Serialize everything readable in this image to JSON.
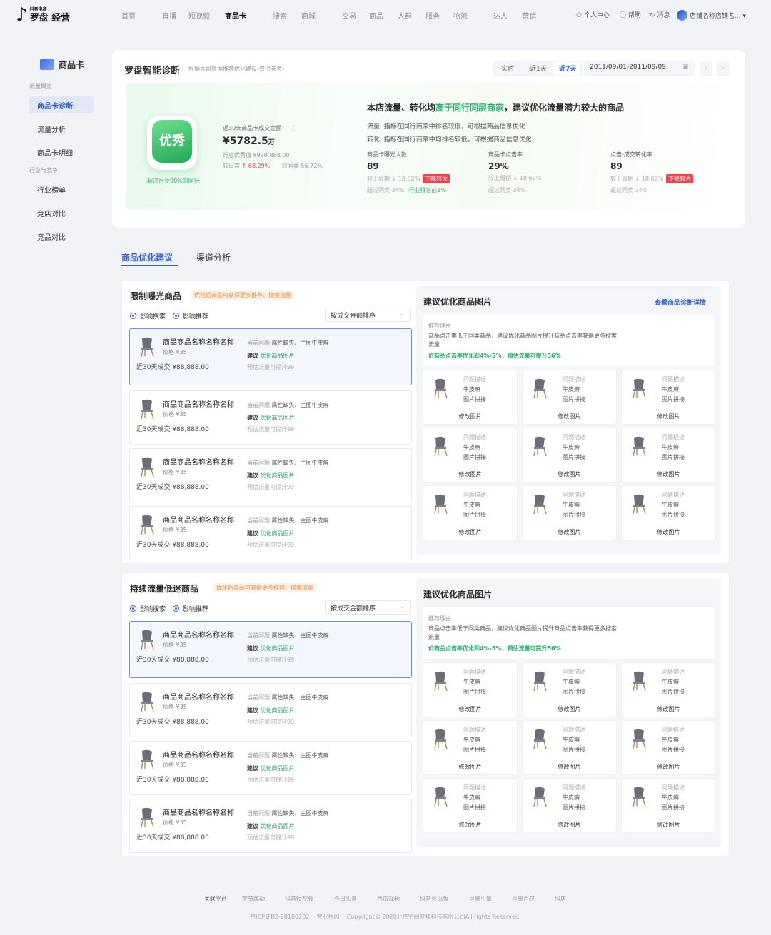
{
  "header": {
    "logo_small": "抖音电商",
    "logo_main": "罗盘 经营",
    "nav": [
      "首页",
      "直播",
      "短视频",
      "商品卡",
      "搜索",
      "商城",
      "交易",
      "商品",
      "人群",
      "服务",
      "物流",
      "达人",
      "营销"
    ],
    "active_nav": "商品卡",
    "right": {
      "user_center": "个人中心",
      "help": "帮助",
      "messages": "消息",
      "shop_name": "店铺名称店铺名..."
    }
  },
  "sidebar": {
    "title": "商品卡",
    "groups": [
      {
        "label": "流量概览",
        "items": [
          "商品卡诊断",
          "流量分析",
          "商品卡明细"
        ]
      },
      {
        "label": "行业与竞争",
        "items": [
          "行业榜单",
          "竞店对比",
          "竞品对比"
        ]
      }
    ],
    "active": "商品卡诊断"
  },
  "diagnosis": {
    "title": "罗盘智能诊断",
    "subtitle": "根据大盘数据推荐优化建议(仅供参考)",
    "date_tabs": [
      "实时",
      "近1天",
      "近7天"
    ],
    "active_tab": "近7天",
    "date_range": "2011/09/01-2011/09/09",
    "badge": "优秀",
    "badge_note": "超过行业90%的同行",
    "gmv_label": "近30天商品卡成交金额",
    "gmv_value": "¥5782.5",
    "gmv_unit": "万",
    "industry_excellent": "行业优秀值 ¥999,888.00",
    "compare_daily": "较日常",
    "compare_daily_val": "68.29%",
    "compare_peer": "较同类",
    "compare_peer_val": "56.72%",
    "headline_pre": "本店流量、转化均",
    "headline_green": "高于同行同层商家",
    "headline_post": "，建议优化流量潜力较大的商品",
    "line1_key": "流量",
    "line1_text": "指标在同行商家中排名较低，可根据商品信息优化",
    "line2_key": "转化",
    "line2_text": "指标在同行商家中均排名较低，可根据商品信息优化",
    "metrics": [
      {
        "label": "商品卡曝光人数",
        "value": "89",
        "wow": "较上周期 ↓ 18.62%",
        "tag": "下降较大",
        "peer": "超过同类 34%",
        "extra": "行业排名前1%"
      },
      {
        "label": "商品卡点击率",
        "value": "29%",
        "wow": "较上周期 ↓ 18.62%",
        "tag": "",
        "peer": "超过同类 34%",
        "extra": ""
      },
      {
        "label": "点击-成交转化率",
        "value": "89",
        "wow": "较上周期 ↓ 18.62%",
        "tag": "下降较大",
        "peer": "超过同类 34%",
        "extra": ""
      }
    ]
  },
  "tabs": [
    "商品优化建议",
    "渠道分析"
  ],
  "active_main_tab": "商品优化建议",
  "sections": [
    {
      "title": "限制曝光商品",
      "hint": "优化后商品可获得更多推荐、搜索流量"
    },
    {
      "title": "持续流量低迷商品",
      "hint": "优化后商品可获得更多推荐、搜索流量"
    }
  ],
  "filters": {
    "radio1": "影响搜索",
    "radio2": "影响推荐",
    "sort": "按成交金额排序"
  },
  "product": {
    "name": "商品商品名称名称名称",
    "price": "价格 ¥35",
    "sales": "近30天成交 ¥88,888.00",
    "issue_label": "当前问题",
    "issue": "属性缺失、主图牛皮癣",
    "advice_label": "建议",
    "advice": "优化商品图片",
    "estimate": "预估流量可提升99"
  },
  "image_panel": {
    "title": "建议优化商品图片",
    "link": "查看商品诊断详情",
    "reason_label": "推荐理由",
    "reason": "商品点击率低于同类商品，建议优化商品图片提升商品点击率获得更多搜索流量",
    "reason_green": "价商品点击率优化到4%-5%，预估流量可提升56%",
    "cell": {
      "desc_label": "问题描述",
      "desc1": "牛皮癣",
      "desc2": "图片拼接",
      "button": "修改图片"
    }
  },
  "footer": {
    "label": "关联平台",
    "links": [
      "字节跳动",
      "抖音短视频",
      "今日头条",
      "西瓜视频",
      "抖音火山版",
      "巨量引擎",
      "巨量百应",
      "抖店"
    ],
    "icp": "京ICP证B2-20180202",
    "license": "营业执照",
    "copyright": "Copyright© 2020北京空间变换科技有限公司All rights Reserved."
  },
  "colors": {
    "primary": "#2f5fd0",
    "green": "#22b06a",
    "red": "#f0434a",
    "orange": "#f08c3a"
  }
}
